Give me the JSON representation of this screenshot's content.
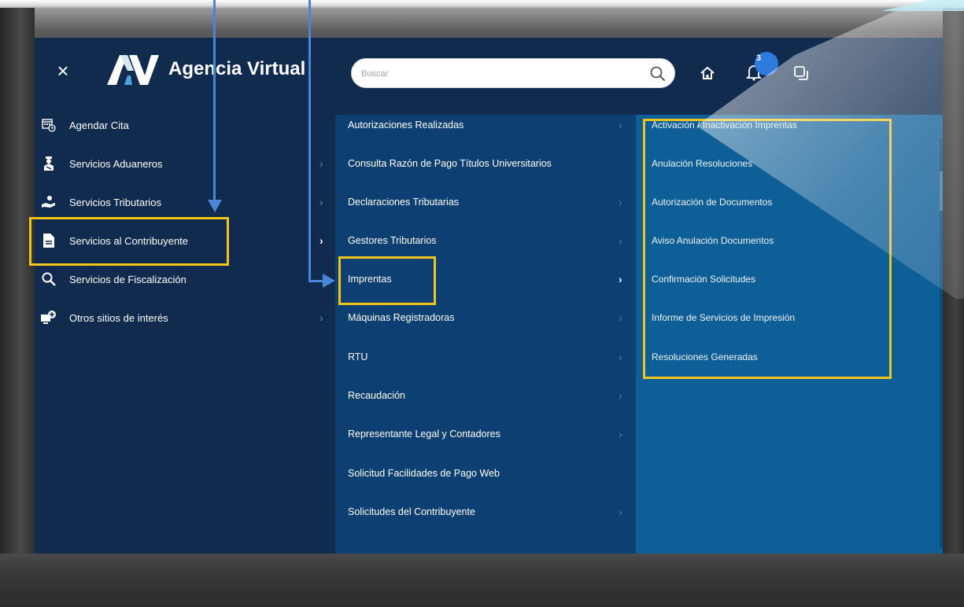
{
  "app": {
    "close_symbol": "×",
    "brand": "Agencia Virtual",
    "logo_icon": "av-logo-icon"
  },
  "search": {
    "placeholder": "Buscar",
    "icon": "search-icon"
  },
  "header_icons": {
    "home": "home-icon",
    "bell": "bell-icon",
    "window": "window-icon",
    "notification_count": "3"
  },
  "menu_level1": [
    {
      "label": "Agendar Cita",
      "icon": "calendar-icon",
      "has_submenu": false
    },
    {
      "label": "Servicios Aduaneros",
      "icon": "customs-officer-icon",
      "has_submenu": true
    },
    {
      "label": "Servicios Tributarios",
      "icon": "hand-money-icon",
      "has_submenu": true
    },
    {
      "label": "Servicios al Contribuyente",
      "icon": "document-icon",
      "has_submenu": true,
      "active": true
    },
    {
      "label": "Servicios de Fiscalización",
      "icon": "magnifier-icon",
      "has_submenu": false
    },
    {
      "label": "Otros sitios de interés",
      "icon": "monitor-plus-icon",
      "has_submenu": true
    }
  ],
  "menu_level2": [
    {
      "label": "Autorizaciones Realizadas",
      "has_submenu": true
    },
    {
      "label": "Consulta Razón de Pago Títulos Universitarios",
      "has_submenu": false
    },
    {
      "label": "Declaraciones Tributarias",
      "has_submenu": true
    },
    {
      "label": "Gestores Tributarios",
      "has_submenu": true
    },
    {
      "label": "Imprentas",
      "has_submenu": true,
      "active": true
    },
    {
      "label": "Máquinas Registradoras",
      "has_submenu": true
    },
    {
      "label": "RTU",
      "has_submenu": true
    },
    {
      "label": "Recaudación",
      "has_submenu": true
    },
    {
      "label": "Representante Legal y Contadores",
      "has_submenu": true
    },
    {
      "label": "Solicitud Facilidades de Pago Web",
      "has_submenu": false
    },
    {
      "label": "Solicitudes del Contribuyente",
      "has_submenu": true
    }
  ],
  "menu_level3": [
    {
      "label": "Activación / Inactivación Imprentas"
    },
    {
      "label": "Anulación Resoluciones"
    },
    {
      "label": "Autorización de Documentos"
    },
    {
      "label": "Aviso Anulación Documentos"
    },
    {
      "label": "Confirmación Solicitudes"
    },
    {
      "label": "Informe de Servicios de Impresión"
    },
    {
      "label": "Resoluciones Generadas"
    }
  ],
  "colors": {
    "highlight": "#f0c419",
    "arrow": "#4a86d8",
    "level1_bg": "#112b4e",
    "level2_bg": "#0d3f73",
    "level3_bg": "#0e5e97"
  }
}
